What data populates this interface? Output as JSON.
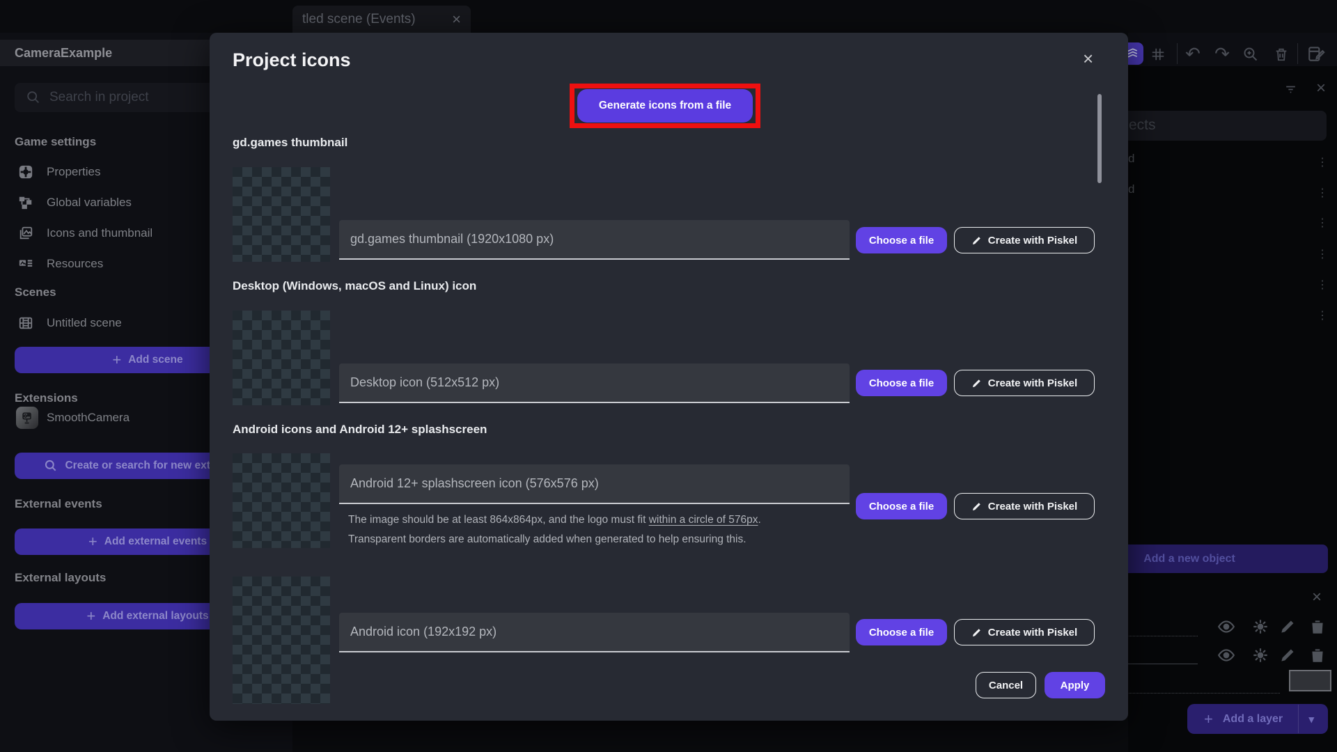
{
  "tab": {
    "label": "tled scene (Events)",
    "close_icon": "×"
  },
  "toolbar": {
    "icons": [
      "layers-icon",
      "grid-icon",
      "undo-icon",
      "redo-icon",
      "zoom-in-icon",
      "trash-icon",
      "edit-scene-icon"
    ],
    "undo_glyph": "↶",
    "redo_glyph": "↷"
  },
  "sidebar": {
    "project_name": "CameraExample",
    "search_placeholder": "Search in project",
    "game_settings": {
      "title": "Game settings",
      "items": [
        "Properties",
        "Global variables",
        "Icons and thumbnail",
        "Resources"
      ]
    },
    "scenes": {
      "title": "Scenes",
      "items": [
        "Untitled scene"
      ],
      "add_button": "Add scene"
    },
    "extensions": {
      "title": "Extensions",
      "items": [
        "SmoothCamera"
      ],
      "search_button": "Create or search for new extensions"
    },
    "external_events": {
      "title": "External events",
      "add_button": "Add external events"
    },
    "external_layouts": {
      "title": "External layouts",
      "add_button": "Add external layouts"
    }
  },
  "right_panel": {
    "search_visible_text": "ects",
    "truncated_rows": [
      "d",
      "d"
    ],
    "kebab_glyph": "⋮",
    "add_object_button": "Add a new object",
    "add_layer_button": "Add a layer",
    "caret_glyph": "▾",
    "close_icon": "×"
  },
  "modal": {
    "title": "Project icons",
    "close_icon": "×",
    "generate_button": "Generate icons from a file",
    "row_buttons": {
      "choose": "Choose a file",
      "piskel": "Create with Piskel"
    },
    "sections": {
      "gdgames": {
        "label": "gd.games thumbnail",
        "placeholder": "gd.games thumbnail (1920x1080 px)"
      },
      "desktop": {
        "label": "Desktop (Windows, macOS and Linux) icon",
        "placeholder": "Desktop icon (512x512 px)"
      },
      "android": {
        "label": "Android icons and Android 12+ splashscreen",
        "splash_placeholder": "Android 12+ splashscreen icon (576x576 px)",
        "helper_prefix": "The image should be at least 864x864px, and the logo must fit ",
        "helper_link": "within a circle of 576px",
        "helper_dot": ".",
        "helper_line2": "Transparent borders are automatically added when generated to help ensuring this.",
        "icon_placeholder": "Android icon (192x192 px)"
      }
    },
    "cancel_button": "Cancel",
    "apply_button": "Apply"
  },
  "colors": {
    "accent": "#6142e4",
    "generate_purple": "#5b3ce0",
    "highlight_red": "#ee1010"
  }
}
